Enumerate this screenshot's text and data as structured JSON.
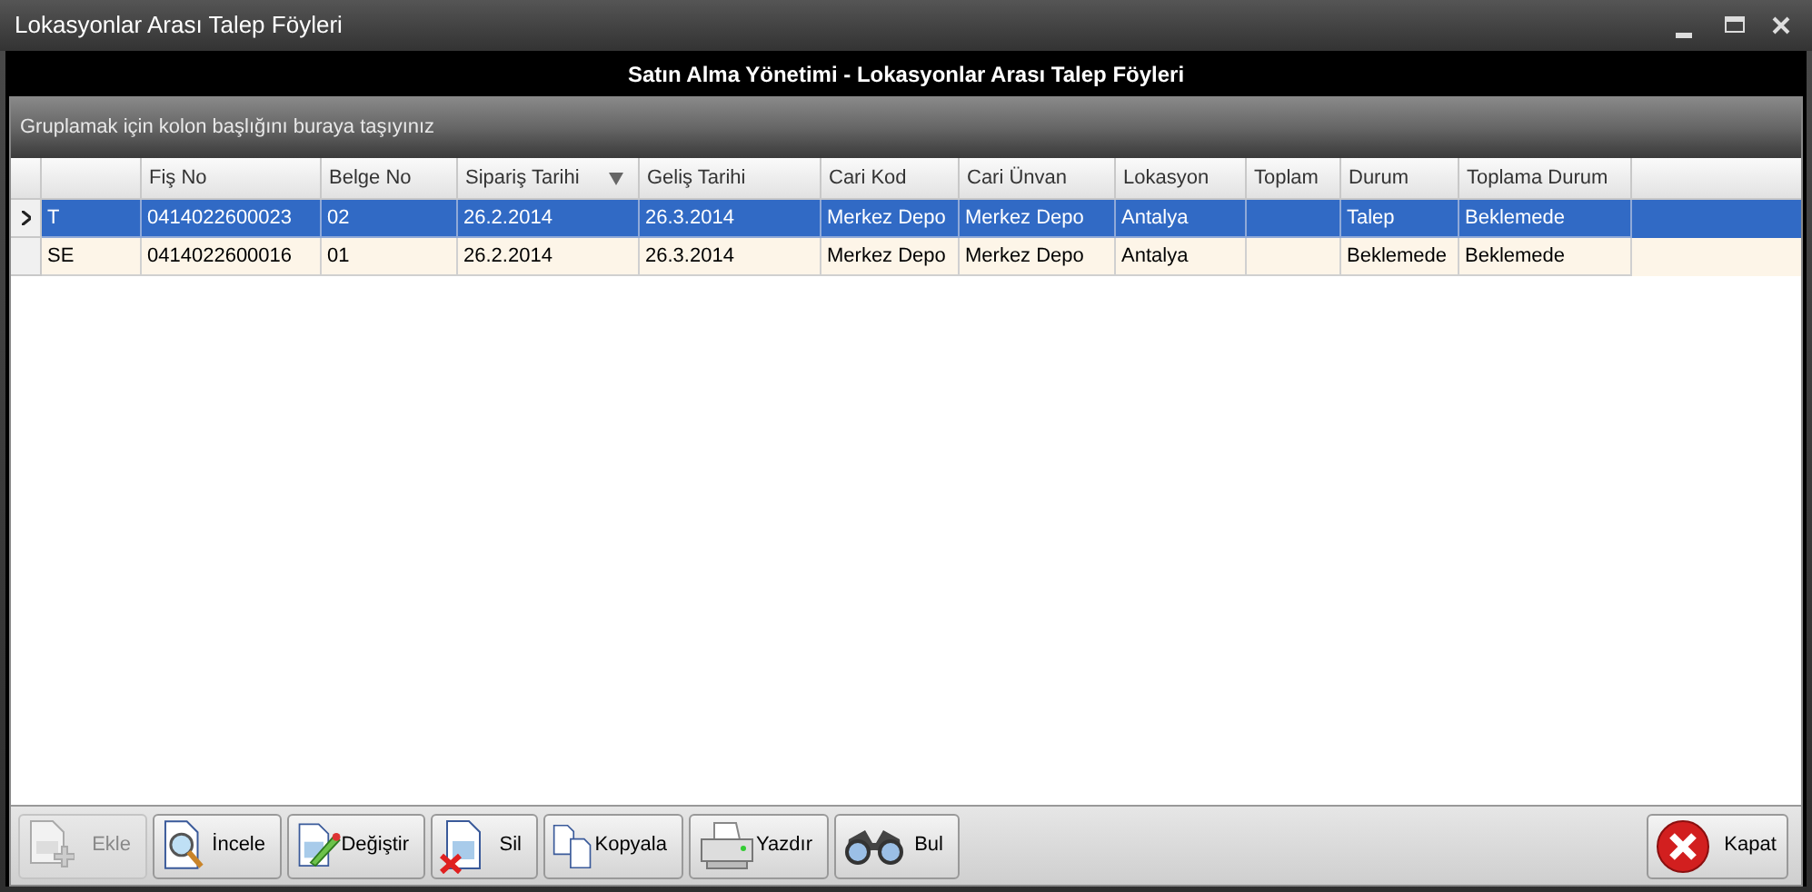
{
  "window": {
    "title": "Lokasyonlar Arası Talep Föyleri"
  },
  "header": {
    "title": "Satın Alma Yönetimi - Lokasyonlar Arası Talep Föyleri"
  },
  "group_panel": {
    "hint": "Gruplamak için kolon başlığını buraya taşıyınız"
  },
  "table": {
    "columns": [
      {
        "sorted": false
      },
      {
        "label": "Fiş No",
        "sorted": false
      },
      {
        "label": "Belge No",
        "sorted": false
      },
      {
        "label": "Sipariş Tarihi",
        "sorted": true
      },
      {
        "label": "Geliş Tarihi",
        "sorted": false
      },
      {
        "label": "Cari Kod",
        "sorted": false
      },
      {
        "label": "Cari Ünvan",
        "sorted": false
      },
      {
        "label": "Lokasyon",
        "sorted": false
      },
      {
        "label": "Toplam",
        "sorted": false
      },
      {
        "label": "Durum",
        "sorted": false
      },
      {
        "label": "Toplama Durum",
        "sorted": false
      }
    ],
    "rows": [
      {
        "selected": true,
        "cells": [
          "T",
          "0414022600023",
          "02",
          "26.2.2014",
          "26.3.2014",
          "Merkez Depo",
          "Merkez Depo",
          "Antalya",
          "",
          "Talep",
          "Beklemede"
        ]
      },
      {
        "selected": false,
        "cells": [
          "SE",
          "0414022600016",
          "01",
          "26.2.2014",
          "26.3.2014",
          "Merkez Depo",
          "Merkez Depo",
          "Antalya",
          "",
          "Beklemede",
          "Beklemede"
        ]
      }
    ]
  },
  "toolbar": [
    {
      "kind": "add",
      "label": "Ekle",
      "disabled": true
    },
    {
      "kind": "view",
      "label": "İncele",
      "disabled": false
    },
    {
      "kind": "edit",
      "label": "Değiştir",
      "disabled": false
    },
    {
      "kind": "delete",
      "label": "Sil",
      "disabled": false
    },
    {
      "kind": "copy",
      "label": "Kopyala",
      "disabled": false
    },
    {
      "kind": "print",
      "label": "Yazdır",
      "disabled": false
    },
    {
      "kind": "find",
      "label": "Bul",
      "disabled": false
    }
  ],
  "close_button": {
    "label": "Kapat"
  }
}
